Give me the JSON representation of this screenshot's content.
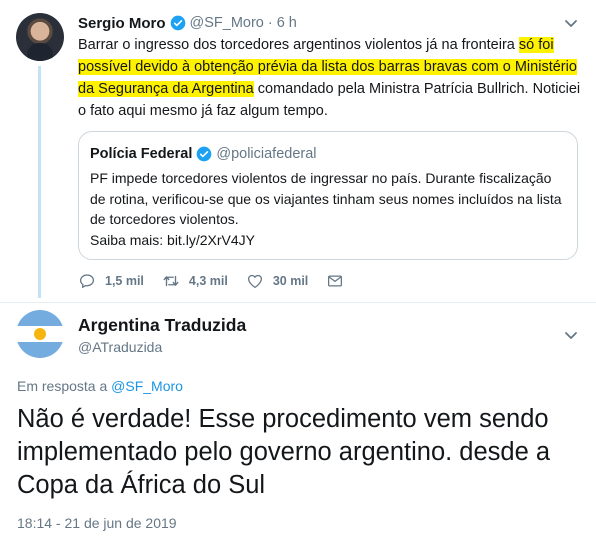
{
  "tweet1": {
    "author_name": "Sergio Moro",
    "handle": "@SF_Moro",
    "separator": "·",
    "time": "6 h",
    "text_before": "Barrar o ingresso dos torcedores argentinos violentos já na fronteira ",
    "text_highlight_1": "só foi",
    "text_gap": " ",
    "text_highlight_2": "possível devido à obtenção prévia da lista dos barras bravas com o Ministério da Segurança da Argentina",
    "text_after": " comandado pela Ministra Patrícia Bullrich. Noticiei o fato aqui mesmo já faz algum tempo.",
    "highlight_color": "#fff200",
    "quote": {
      "author_name": "Polícia Federal",
      "handle": "@policiafederal",
      "text": "PF impede torcedores violentos de ingressar no país. Durante fiscalização de rotina, verificou-se que os viajantes tinham seus nomes incluídos na lista de torcedores violentos.",
      "link_text": "Saiba mais: bit.ly/2XrV4JY"
    },
    "actions": {
      "reply_icon": "reply-icon",
      "reply_count": "1,5 mil",
      "retweet_icon": "retweet-icon",
      "retweet_count": "4,3 mil",
      "like_icon": "heart-icon",
      "like_count": "30 mil",
      "dm_icon": "envelope-icon"
    }
  },
  "tweet2": {
    "author_name": "Argentina Traduzida",
    "handle": "@ATraduzida",
    "reply_prefix": "Em resposta a ",
    "reply_handle": "@SF_Moro",
    "text": "Não é verdade! Esse procedimento vem sendo implementado pelo governo argentino. desde a Copa da África do Sul",
    "date": "18:14 - 21 de jun de 2019"
  },
  "colors": {
    "link_blue": "#1b95e0",
    "verified_blue": "#1da1f2",
    "muted_gray": "#657786",
    "thread_line": "#c4e2f6"
  }
}
